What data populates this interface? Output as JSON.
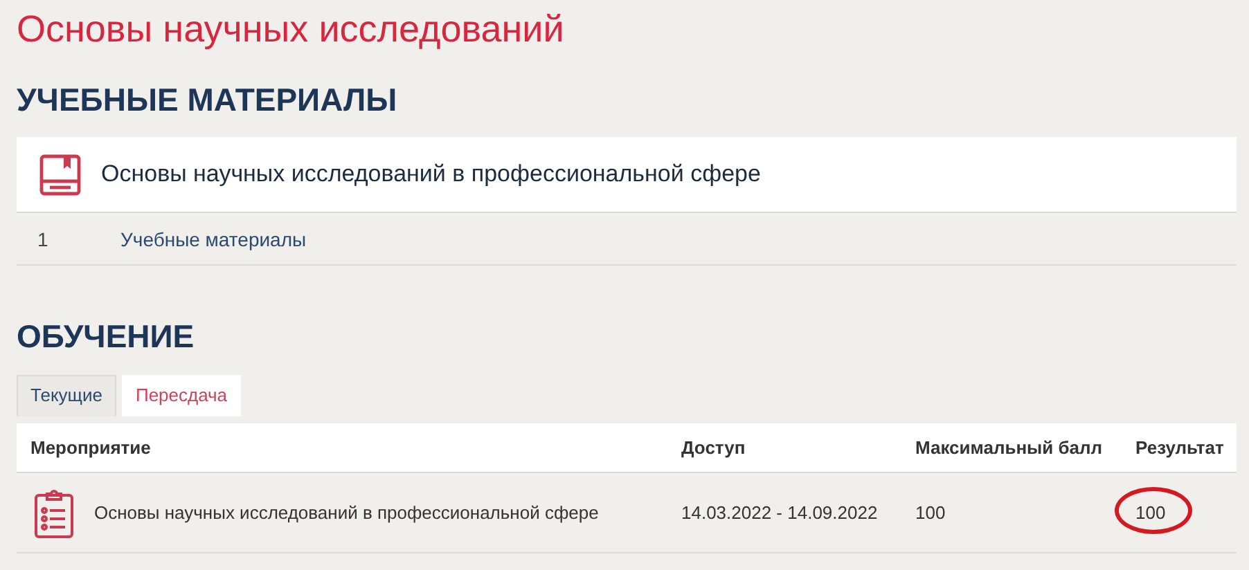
{
  "page_title": "Основы научных исследований",
  "materials": {
    "heading": "УЧЕБНЫЕ МАТЕРИАЛЫ",
    "course_title": "Основы научных исследований в профессиональной сфере",
    "items": [
      {
        "number": "1",
        "label": "Учебные материалы"
      }
    ]
  },
  "learning": {
    "heading": "ОБУЧЕНИЕ",
    "tabs": [
      {
        "label": "Текущие",
        "selected": true
      },
      {
        "label": "Пересдача",
        "selected": false
      }
    ],
    "columns": [
      "Мероприятие",
      "Доступ",
      "Максимальный балл",
      "Результат"
    ],
    "rows": [
      {
        "activity": "Основы научных исследований в профессиональной сфере",
        "access": "14.03.2022 - 14.09.2022",
        "max_score": "100",
        "result": "100",
        "result_circled": true
      }
    ]
  }
}
